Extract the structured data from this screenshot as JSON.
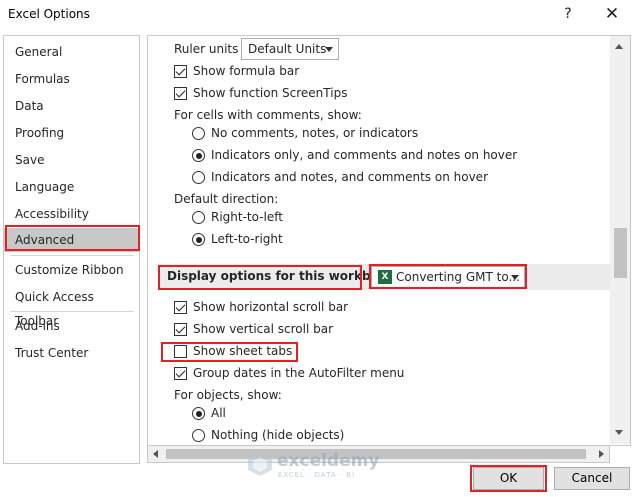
{
  "window": {
    "title": "Excel Options",
    "help_label": "?",
    "close_label": "✕"
  },
  "sidebar": {
    "items": [
      {
        "label": "General"
      },
      {
        "label": "Formulas"
      },
      {
        "label": "Data"
      },
      {
        "label": "Proofing"
      },
      {
        "label": "Save"
      },
      {
        "label": "Language"
      },
      {
        "label": "Accessibility"
      },
      {
        "label": "Advanced",
        "selected": true
      },
      {
        "label": "Customize Ribbon"
      },
      {
        "label": "Quick Access Toolbar"
      },
      {
        "label": "Add-ins"
      },
      {
        "label": "Trust Center"
      }
    ]
  },
  "content": {
    "ruler_units": {
      "label": "Ruler units",
      "value": "Default Units"
    },
    "show_formula_bar": {
      "label": "Show formula bar",
      "checked": true
    },
    "show_function_screentips": {
      "label": "Show function ScreenTips",
      "checked": true
    },
    "comments_heading": "For cells with comments, show:",
    "comments_options": [
      {
        "label": "No comments, notes, or indicators",
        "checked": false
      },
      {
        "label": "Indicators only, and comments and notes on hover",
        "checked": true
      },
      {
        "label": "Indicators and notes, and comments on hover",
        "checked": false
      }
    ],
    "direction_heading": "Default direction:",
    "direction_options": [
      {
        "label": "Right-to-left",
        "checked": false
      },
      {
        "label": "Left-to-right",
        "checked": true
      }
    ],
    "workbook_section": {
      "title": "Display options for this workbook:",
      "workbook_value": "Converting GMT to...",
      "workbook_icon": "X"
    },
    "show_hscroll": {
      "label": "Show horizontal scroll bar",
      "checked": true
    },
    "show_vscroll": {
      "label": "Show vertical scroll bar",
      "checked": true
    },
    "show_sheet_tabs": {
      "label": "Show sheet tabs",
      "checked": false
    },
    "group_dates": {
      "label": "Group dates in the AutoFilter menu",
      "checked": true
    },
    "objects_heading": "For objects, show:",
    "objects_options": [
      {
        "label": "All",
        "checked": true
      },
      {
        "label": "Nothing (hide objects)",
        "checked": false
      }
    ]
  },
  "watermark": {
    "name": "exceldemy",
    "tagline": "EXCEL · DATA · BI"
  },
  "buttons": {
    "ok": "OK",
    "cancel": "Cancel"
  },
  "colors": {
    "highlight": "#e41f26",
    "selected_nav": "#c8c8c8",
    "excel_green": "#1d6f42"
  }
}
